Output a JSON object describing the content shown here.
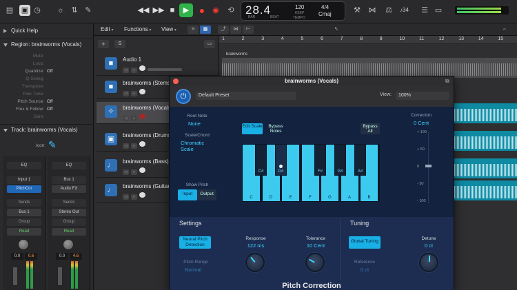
{
  "transport": {
    "position": "28.4",
    "bar_label": "BAR",
    "beat_label": "BEAT",
    "tempo_value": "120",
    "keep_label": "KEEP",
    "tempo_label": "TEMPO",
    "time_sig": "4/4",
    "key": "Cmaj",
    "count_in": "♪34"
  },
  "quick_help": "Quick Help",
  "region_inspector": {
    "title": "Region: brainworms (Vocals)",
    "params": [
      {
        "k": "Mute:",
        "v": ""
      },
      {
        "k": "Loop:",
        "v": ""
      },
      {
        "k": "Quantize:",
        "v": "Off"
      },
      {
        "k": "Q-Swing:",
        "v": ""
      },
      {
        "k": "Transpose:",
        "v": ""
      },
      {
        "k": "Fine Tune:",
        "v": ""
      },
      {
        "k": "Pitch Source:",
        "v": "Off"
      },
      {
        "k": "Flex & Follow:",
        "v": "Off"
      },
      {
        "k": "Gain:",
        "v": ""
      }
    ]
  },
  "track_inspector": {
    "title": "Track: brainworms (Vocals)",
    "icon_label": "Icon:"
  },
  "channel_strips": [
    {
      "eq": "EQ",
      "input": "Input 1",
      "plugin": "PitchCor",
      "sends": "Sends",
      "output": "Bus 1",
      "group": "Group",
      "read": "Read",
      "vol": "0.0",
      "pan": "0.6"
    },
    {
      "eq": "EQ",
      "input": "Bus 1",
      "plugin": "Audio FX",
      "sends": "Sends",
      "output": "Stereo Out",
      "group": "Group",
      "read": "Read",
      "vol": "0.0",
      "pan": "4.6"
    }
  ],
  "edit_menus": [
    "Edit",
    "Functions",
    "View"
  ],
  "tracks": [
    {
      "name": "Audio 1",
      "icon": "■"
    },
    {
      "name": "brainworms (Stems)",
      "icon": "■"
    },
    {
      "name": "brainworms (Vocals)",
      "icon": "✧"
    },
    {
      "name": "brainworms (Drums)",
      "icon": "▣"
    },
    {
      "name": "brainworms (Bass)",
      "icon": "♩"
    },
    {
      "name": "brainworms (Guitar)",
      "icon": "♩"
    }
  ],
  "ruler": [
    "1",
    "2",
    "3",
    "4",
    "5",
    "6",
    "7",
    "8",
    "9",
    "10",
    "11",
    "12",
    "13",
    "14",
    "15"
  ],
  "region_label": "brainworms",
  "plugin": {
    "window_title": "brainworms (Vocals)",
    "preset": "Default Preset",
    "view_label": "View:",
    "view_value": "100%",
    "root_note_label": "Root Note",
    "root_note_value": "None",
    "scale_chord_label": "Scale/Chord",
    "scale_chord_value": "Chromatic Scale",
    "edit_scale": "Edit Scale",
    "bypass_notes": "Bypass Notes",
    "bypass_all": "Bypass All",
    "show_pitch_label": "Show Pitch",
    "input_btn": "Input",
    "output_btn": "Output",
    "white_keys": [
      "C",
      "D",
      "E",
      "F",
      "G",
      "A",
      "B"
    ],
    "black_keys": [
      "C#",
      "D#",
      "F#",
      "G#",
      "A#"
    ],
    "correction_label": "Correction",
    "correction_value": "0 Cent",
    "correction_ticks": [
      "+ 100",
      "+ 50",
      "0",
      "- 50",
      "- 100"
    ],
    "settings_title": "Settings",
    "neural_btn": "Neural Pitch Detection",
    "pitch_range_label": "Pitch Range",
    "pitch_range_value": "Normal",
    "response_label": "Response",
    "response_value": "122 ms",
    "tolerance_label": "Tolerance",
    "tolerance_value": "10 Cent",
    "tuning_title": "Tuning",
    "global_tuning_btn": "Global Tuning",
    "reference_label": "Reference",
    "reference_value": "0 ct",
    "detune_label": "Detune",
    "detune_value": "0 ct",
    "footer": "Pitch Correction"
  },
  "colors": {
    "accent_cyan": "#19b0e6",
    "plugin_bg": "#13223f",
    "record": "#ff3b30",
    "play": "#2fb34a"
  }
}
